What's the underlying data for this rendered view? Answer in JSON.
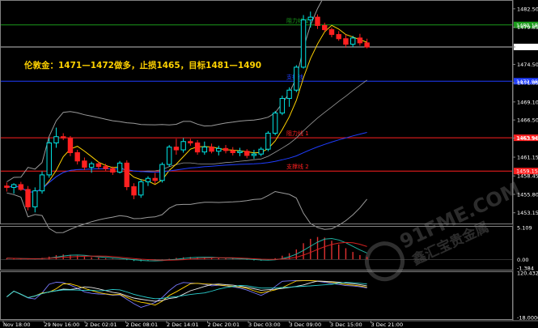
{
  "annotation": "伦敦金：1471—1472做多，止损1465，目标1481—1490",
  "watermark": {
    "brand": "91FME.COM",
    "tagline": "鑫汇宝贵金属"
  },
  "colors": {
    "up": "#00e5e5",
    "down": "#ff2020",
    "price_line": "#ffffff",
    "grid": "#808080",
    "resistance": "#ff2a2a",
    "support": "#1414d0",
    "bb_band": "#9a9a9a",
    "ma_fast": "#ffd200",
    "ma_slow": "#1f3dff"
  },
  "chart_data": [
    {
      "type": "candlestick",
      "panel": "price",
      "ylim": [
        1451.6,
        1483.3
      ],
      "x_ticks": [
        "Nov 18:00",
        "29 Nov 16:00",
        "2 Dec 02:01",
        "2 Dec 08:01",
        "2 Dec 14:01",
        "2 Dec 20:01",
        "3 Dec 03:00",
        "3 Dec 09:00",
        "3 Dec 15:00",
        "3 Dec 21:00"
      ],
      "y_ticks": [
        "1482.50",
        "1479.85",
        "1477.01",
        "1474.50",
        "1471.85",
        "1469.10",
        "1466.50",
        "1463.90",
        "1461.15",
        "1458.45",
        "1455.80",
        "1453.15"
      ],
      "current_price": "1477.01",
      "price_labels": [
        {
          "text": "1480.18",
          "value": 1480.18,
          "color": "#1a9a1a"
        },
        {
          "text": "1472.08",
          "value": 1472.08,
          "color": "#1f3dff"
        },
        {
          "text": "1463.94",
          "value": 1463.94,
          "color": "#ff2020"
        },
        {
          "text": "1459.15",
          "value": 1459.15,
          "color": "#ff2020"
        }
      ],
      "levels": [
        {
          "label": "阻力线 1",
          "value": 1480.18,
          "color": "#1a9a1a"
        },
        {
          "label": "支撑线",
          "value": 1472.08,
          "color": "#1f3dff"
        },
        {
          "label": "阻力线 1",
          "value": 1463.94,
          "color": "#ff2020"
        },
        {
          "label": "支撑线 2",
          "value": 1459.15,
          "color": "#ff2020"
        }
      ],
      "candles": [
        [
          1457.0,
          1457.5,
          1456.2,
          1456.8
        ],
        [
          1456.8,
          1457.4,
          1455.9,
          1457.2
        ],
        [
          1457.2,
          1457.6,
          1456.3,
          1456.5
        ],
        [
          1456.5,
          1457.0,
          1453.5,
          1454.0
        ],
        [
          1454.0,
          1456.8,
          1453.2,
          1456.3
        ],
        [
          1456.3,
          1459.1,
          1455.9,
          1458.6
        ],
        [
          1458.6,
          1463.9,
          1458.2,
          1463.2
        ],
        [
          1463.2,
          1465.4,
          1462.5,
          1464.1
        ],
        [
          1464.1,
          1464.6,
          1463.6,
          1463.9
        ],
        [
          1463.9,
          1464.2,
          1461.3,
          1461.8
        ],
        [
          1461.8,
          1462.2,
          1460.1,
          1460.6
        ],
        [
          1460.6,
          1461.1,
          1459.3,
          1459.7
        ],
        [
          1459.7,
          1460.5,
          1458.9,
          1460.2
        ],
        [
          1460.2,
          1460.5,
          1459.4,
          1459.8
        ],
        [
          1459.8,
          1460.2,
          1459.2,
          1459.5
        ],
        [
          1459.5,
          1459.8,
          1458.6,
          1459.0
        ],
        [
          1459.0,
          1460.6,
          1458.8,
          1460.3
        ],
        [
          1460.3,
          1460.7,
          1456.4,
          1456.9
        ],
        [
          1456.9,
          1457.4,
          1455.1,
          1455.7
        ],
        [
          1455.7,
          1458.0,
          1455.3,
          1457.6
        ],
        [
          1457.6,
          1458.4,
          1457.0,
          1458.1
        ],
        [
          1458.1,
          1458.9,
          1457.3,
          1457.8
        ],
        [
          1457.8,
          1460.4,
          1457.5,
          1460.1
        ],
        [
          1460.1,
          1462.9,
          1459.8,
          1462.6
        ],
        [
          1462.6,
          1463.8,
          1461.5,
          1462.2
        ],
        [
          1462.2,
          1463.9,
          1461.8,
          1463.4
        ],
        [
          1463.4,
          1463.8,
          1462.8,
          1463.2
        ],
        [
          1463.2,
          1463.6,
          1461.5,
          1461.9
        ],
        [
          1461.9,
          1463.4,
          1461.5,
          1462.6
        ],
        [
          1462.6,
          1463.1,
          1461.7,
          1462.0
        ],
        [
          1462.0,
          1462.8,
          1461.4,
          1462.4
        ],
        [
          1462.4,
          1462.9,
          1461.7,
          1462.1
        ],
        [
          1462.1,
          1462.6,
          1461.4,
          1461.8
        ],
        [
          1461.8,
          1462.5,
          1461.3,
          1462.0
        ],
        [
          1462.0,
          1462.3,
          1461.0,
          1461.4
        ],
        [
          1461.4,
          1462.2,
          1460.9,
          1461.6
        ],
        [
          1461.6,
          1462.6,
          1461.3,
          1462.3
        ],
        [
          1462.3,
          1464.9,
          1462.0,
          1464.6
        ],
        [
          1464.6,
          1467.8,
          1464.3,
          1467.5
        ],
        [
          1467.5,
          1470.0,
          1467.2,
          1469.6
        ],
        [
          1469.6,
          1471.2,
          1468.4,
          1470.8
        ],
        [
          1470.8,
          1474.4,
          1470.5,
          1474.1
        ],
        [
          1474.1,
          1481.6,
          1473.9,
          1480.9
        ],
        [
          1480.9,
          1482.1,
          1479.8,
          1481.3
        ],
        [
          1481.3,
          1481.7,
          1479.6,
          1480.1
        ],
        [
          1480.1,
          1480.5,
          1479.2,
          1479.5
        ],
        [
          1479.5,
          1479.8,
          1478.4,
          1478.8
        ],
        [
          1478.8,
          1479.3,
          1477.9,
          1478.2
        ],
        [
          1478.2,
          1478.8,
          1476.9,
          1477.4
        ],
        [
          1477.4,
          1478.6,
          1477.0,
          1478.3
        ],
        [
          1478.3,
          1478.9,
          1477.2,
          1477.6
        ],
        [
          1477.6,
          1478.2,
          1476.8,
          1477.0
        ]
      ]
    },
    {
      "type": "histogram",
      "panel": "macd",
      "ylim": [
        -1.384,
        5.109
      ],
      "y_ticks": [
        "5.109",
        "0.00",
        "-1.384"
      ],
      "values": [
        0.2,
        0.15,
        0.1,
        0.05,
        0.1,
        0.25,
        0.45,
        0.7,
        0.8,
        0.75,
        0.6,
        0.45,
        0.35,
        0.3,
        0.2,
        0.1,
        0.05,
        -0.1,
        -0.25,
        -0.3,
        -0.2,
        -0.15,
        -0.05,
        0.1,
        0.25,
        0.35,
        0.4,
        0.35,
        0.3,
        0.25,
        0.2,
        0.15,
        0.1,
        0.05,
        -0.05,
        -0.15,
        -0.2,
        -0.1,
        0.2,
        0.6,
        1.0,
        1.6,
        2.6,
        3.3,
        3.6,
        3.5,
        3.0,
        2.4,
        1.8,
        1.2,
        0.7,
        0.4
      ]
    },
    {
      "type": "line",
      "panel": "oscillator",
      "ylim": [
        -18.0,
        120.4321
      ],
      "y_ticks": [
        "120.4321",
        "-18.0000"
      ]
    }
  ]
}
